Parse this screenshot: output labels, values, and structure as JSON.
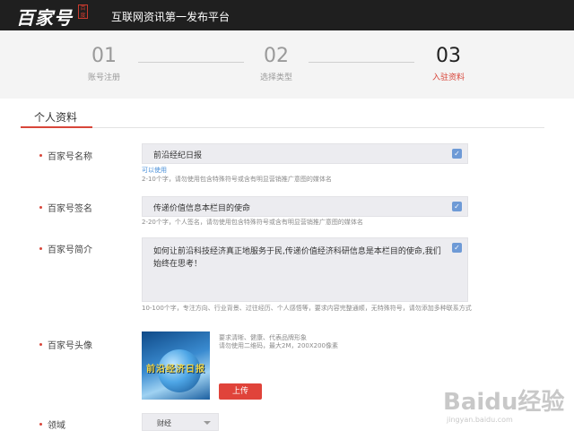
{
  "header": {
    "logo": "百家号",
    "logo_seal": "百度",
    "tagline": "互联网资讯第一发布平台"
  },
  "steps": [
    {
      "num": "01",
      "label": "账号注册",
      "active": false
    },
    {
      "num": "02",
      "label": "选择类型",
      "active": false
    },
    {
      "num": "03",
      "label": "入驻资料",
      "active": true
    }
  ],
  "section": {
    "title": "个人资料"
  },
  "form": {
    "name": {
      "label": "百家号名称",
      "value": "前沿经纪日报",
      "available": "可以使用",
      "hint": "2-10个字，请勿使用包含特殊符号或含有明显营销推广意图的媒体名"
    },
    "signature": {
      "label": "百家号签名",
      "value": "传递价值信息本栏目的使命",
      "hint": "2-20个字，个人签名，请勿使用包含特殊符号或含有明显营销推广意图的媒体名"
    },
    "intro": {
      "label": "百家号简介",
      "value": "如何让前沿科技经济真正地服务于民,传递价值经济科研信息是本栏目的使命,我们始终在思考！",
      "hint": "10-100个字，专注方向、行业背景、过往经历、个人感悟等，要求内容完整通顺，无特殊符号，请勿添加多种联系方式"
    },
    "avatar": {
      "label": "百家号头像",
      "image_text": "前沿经济日报",
      "hint_line1": "要求清晰、健康、代表品牌形象",
      "hint_line2": "请勿使用二维码，最大2M，200X200像素",
      "upload": "上传"
    },
    "domain": {
      "label": "领域",
      "value": "财经"
    }
  },
  "watermark": {
    "brand": "Baidu经验",
    "url": "jingyan.baidu.com"
  },
  "colors": {
    "accent": "#d8463a",
    "check": "#6e9ad6",
    "link": "#4a90d9"
  }
}
